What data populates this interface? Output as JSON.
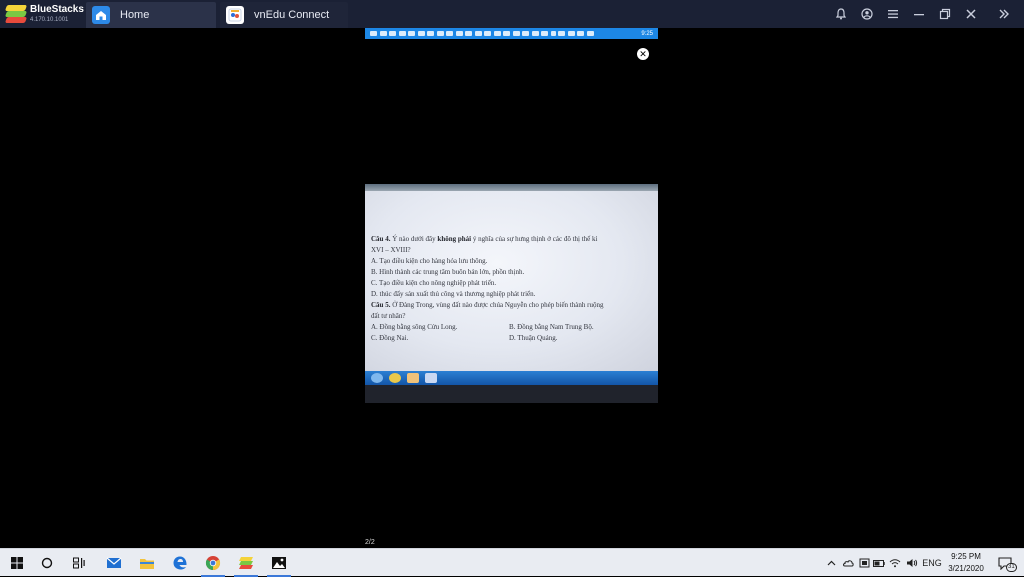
{
  "titlebar": {
    "brand_name": "BlueStacks",
    "brand_version": "4.170.10.1001",
    "tabs": [
      {
        "label": "Home",
        "icon": "home-icon"
      },
      {
        "label": "vnEdu Connect",
        "icon": "vnedu-app-icon"
      }
    ],
    "controls": [
      "bell-icon",
      "account-icon",
      "menu-icon",
      "minimize-icon",
      "restore-icon",
      "close-icon",
      "expand-sidebar-icon"
    ]
  },
  "android_status": {
    "time": "9:25"
  },
  "viewer": {
    "close_symbol": "✕",
    "page_indicator": "2/2"
  },
  "photo_quiz": {
    "q4_prefix": "Câu 4.",
    "q4_text_a": " Ý nào dưới đây ",
    "q4_bold": "không phải",
    "q4_text_b": " ý nghĩa của sự hưng thịnh ở các đô thị thế kỉ",
    "q4_text_c": "XVI – XVIII?",
    "q4_a": "A. Tạo điều kiện cho hàng hóa lưu thông.",
    "q4_b": "B. Hình thành các trung tâm buôn bán lớn, phồn thịnh.",
    "q4_c": "C. Tạo điều kiện cho nông nghiệp phát triển.",
    "q4_d": "D. thúc đẩy sản xuất thủ công và thương nghiệp phát triển.",
    "q5_prefix": "Câu 5.",
    "q5_text_a": " Ở Đàng Trong, vùng đất nào được chúa Nguyễn cho phép biến thành ruộng",
    "q5_text_b": "đất tư nhân?",
    "q5_a": "A. Đồng bằng sông Cửu Long.",
    "q5_b": "B. Đồng bằng Nam Trung Bộ.",
    "q5_c": "C. Đồng Nai.",
    "q5_d": "D. Thuận Quảng."
  },
  "taskbar": {
    "items": [
      "windows-start-icon",
      "cortana-search-icon",
      "task-view-icon",
      "mail-icon",
      "file-explorer-icon",
      "edge-icon",
      "chrome-icon",
      "bluestacks-icon",
      "photos-icon"
    ],
    "tray_language": "ENG",
    "clock_time": "9:25 PM",
    "clock_date": "3/21/2020",
    "notification_count": "31"
  }
}
